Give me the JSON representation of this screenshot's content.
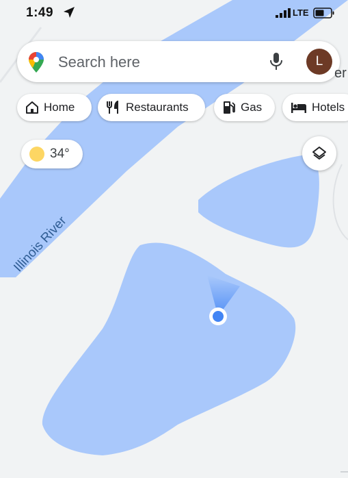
{
  "status_bar": {
    "time": "1:49",
    "network": "LTE"
  },
  "search": {
    "placeholder": "Search here",
    "avatar_letter": "L",
    "edge_text": "er"
  },
  "chips": [
    {
      "label": "Home",
      "icon": "home-icon"
    },
    {
      "label": "Restaurants",
      "icon": "restaurant-icon"
    },
    {
      "label": "Gas",
      "icon": "gas-station-icon"
    },
    {
      "label": "Hotels",
      "icon": "hotel-icon"
    }
  ],
  "weather": {
    "temperature": "34°",
    "icon": "sun-icon"
  },
  "map": {
    "river_label": "Illinois River",
    "colors": {
      "land": "#f1f3f4",
      "water": "#a9c8fb",
      "road": "#ffffff",
      "location_dot": "#4285f4"
    }
  }
}
